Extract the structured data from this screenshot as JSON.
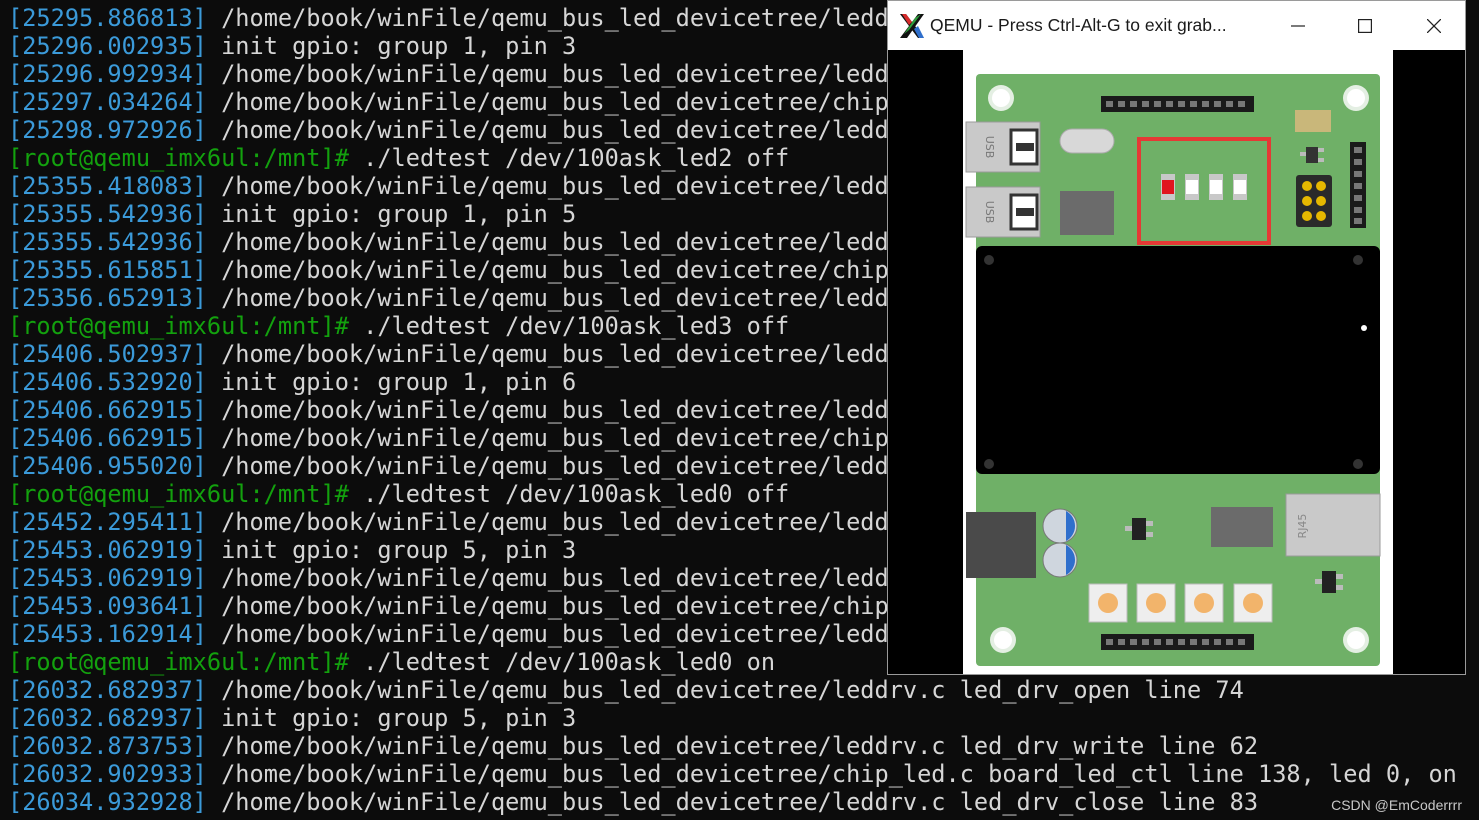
{
  "terminal": {
    "lines": [
      {
        "kind": "log",
        "ts": "[25295.886813]",
        "text": " /home/book/winFile/qemu_bus_led_devicetree/leddr"
      },
      {
        "kind": "log",
        "ts": "[25296.002935]",
        "text": " init gpio: group 1, pin 3"
      },
      {
        "kind": "log",
        "ts": "[25296.992934]",
        "text": " /home/book/winFile/qemu_bus_led_devicetree/leddr"
      },
      {
        "kind": "log",
        "ts": "[25297.034264]",
        "text": " /home/book/winFile/qemu_bus_led_devicetree/chip_"
      },
      {
        "kind": "log",
        "ts": "[25298.972926]",
        "text": " /home/book/winFile/qemu_bus_led_devicetree/leddr"
      },
      {
        "kind": "cmd",
        "prompt": "[root@qemu_imx6ul:/mnt]#",
        "text": " ./ledtest /dev/100ask_led2 off"
      },
      {
        "kind": "log",
        "ts": "[25355.418083]",
        "text": " /home/book/winFile/qemu_bus_led_devicetree/leddr"
      },
      {
        "kind": "log",
        "ts": "[25355.542936]",
        "text": " init gpio: group 1, pin 5"
      },
      {
        "kind": "log",
        "ts": "[25355.542936]",
        "text": " /home/book/winFile/qemu_bus_led_devicetree/leddr"
      },
      {
        "kind": "log",
        "ts": "[25355.615851]",
        "text": " /home/book/winFile/qemu_bus_led_devicetree/chip_"
      },
      {
        "kind": "log",
        "ts": "[25356.652913]",
        "text": " /home/book/winFile/qemu_bus_led_devicetree/leddr"
      },
      {
        "kind": "cmd",
        "prompt": "[root@qemu_imx6ul:/mnt]#",
        "text": " ./ledtest /dev/100ask_led3 off"
      },
      {
        "kind": "log",
        "ts": "[25406.502937]",
        "text": " /home/book/winFile/qemu_bus_led_devicetree/leddr"
      },
      {
        "kind": "log",
        "ts": "[25406.532920]",
        "text": " init gpio: group 1, pin 6"
      },
      {
        "kind": "log",
        "ts": "[25406.662915]",
        "text": " /home/book/winFile/qemu_bus_led_devicetree/leddr"
      },
      {
        "kind": "log",
        "ts": "[25406.662915]",
        "text": " /home/book/winFile/qemu_bus_led_devicetree/chip_"
      },
      {
        "kind": "log",
        "ts": "[25406.955020]",
        "text": " /home/book/winFile/qemu_bus_led_devicetree/leddr"
      },
      {
        "kind": "cmd",
        "prompt": "[root@qemu_imx6ul:/mnt]#",
        "text": " ./ledtest /dev/100ask_led0 off"
      },
      {
        "kind": "log",
        "ts": "[25452.295411]",
        "text": " /home/book/winFile/qemu_bus_led_devicetree/leddr"
      },
      {
        "kind": "log",
        "ts": "[25453.062919]",
        "text": " init gpio: group 5, pin 3"
      },
      {
        "kind": "log",
        "ts": "[25453.062919]",
        "text": " /home/book/winFile/qemu_bus_led_devicetree/leddr"
      },
      {
        "kind": "log",
        "ts": "[25453.093641]",
        "text": " /home/book/winFile/qemu_bus_led_devicetree/chip_"
      },
      {
        "kind": "log",
        "ts": "[25453.162914]",
        "text": " /home/book/winFile/qemu_bus_led_devicetree/leddr"
      },
      {
        "kind": "cmd",
        "prompt": "[root@qemu_imx6ul:/mnt]#",
        "text": " ./ledtest /dev/100ask_led0 on"
      },
      {
        "kind": "log",
        "ts": "[26032.682937]",
        "text": " /home/book/winFile/qemu_bus_led_devicetree/leddrv.c led_drv_open line 74"
      },
      {
        "kind": "log",
        "ts": "[26032.682937]",
        "text": " init gpio: group 5, pin 3"
      },
      {
        "kind": "log",
        "ts": "[26032.873753]",
        "text": " /home/book/winFile/qemu_bus_led_devicetree/leddrv.c led_drv_write line 62"
      },
      {
        "kind": "log",
        "ts": "[26032.902933]",
        "text": " /home/book/winFile/qemu_bus_led_devicetree/chip_led.c board_led_ctl line 138, led 0, on"
      },
      {
        "kind": "log",
        "ts": "[26034.932928]",
        "text": " /home/book/winFile/qemu_bus_led_devicetree/leddrv.c led_drv_close line 83"
      }
    ],
    "colors": {
      "background": "#0c0c0c",
      "text": "#d6d6d6",
      "timestamp": "#3b9ad9",
      "prompt": "#13a10e"
    }
  },
  "qemu_window": {
    "title": "QEMU - Press Ctrl-Alt-G to exit grab...",
    "app_icon": "x-logo-icon",
    "controls": {
      "minimize": "minimize-icon",
      "maximize": "maximize-icon",
      "close": "close-icon"
    },
    "board": {
      "usb_labels": [
        "USB",
        "USB"
      ],
      "rj45_label": "RJ45",
      "leds": [
        {
          "name": "led0",
          "state": "on",
          "color": "#e0141e"
        },
        {
          "name": "led1",
          "state": "off",
          "color": "#ffffff"
        },
        {
          "name": "led2",
          "state": "off",
          "color": "#ffffff"
        },
        {
          "name": "led3",
          "state": "off",
          "color": "#ffffff"
        }
      ],
      "button_count": 4,
      "colors": {
        "pcb": "#6fb067",
        "highlight_box": "#e53935",
        "screen": "#000000",
        "button": "#f2b46b"
      }
    }
  },
  "watermark": "CSDN @EmCoderrrr"
}
